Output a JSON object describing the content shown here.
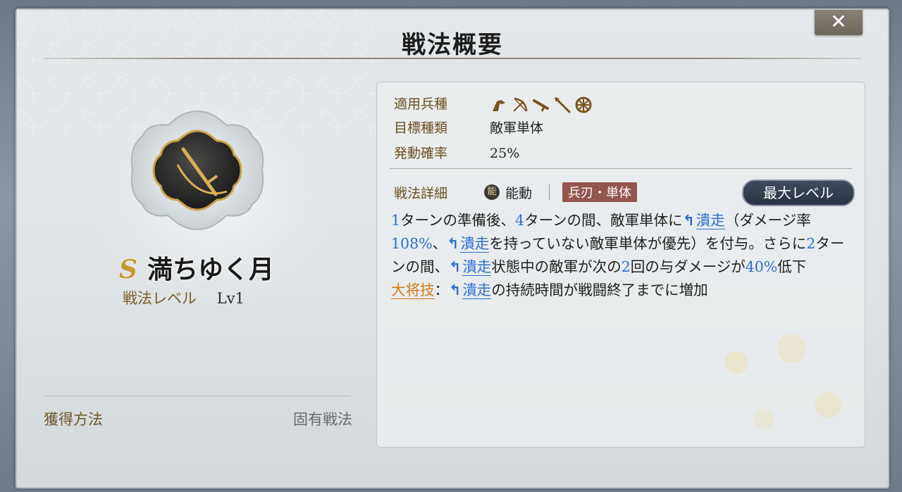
{
  "dialog": {
    "title": "戦法概要",
    "close_label": "✕"
  },
  "tactic": {
    "rank": "S",
    "name": "満ちゆく月",
    "level_label": "戦法レベル",
    "level_value": "Lv1",
    "acquisition_label": "獲得方法",
    "acquisition_value": "固有戦法"
  },
  "info": {
    "unit_label": "適用兵種",
    "unit_icons": [
      "cavalry-icon",
      "bow-icon",
      "gun-icon",
      "spear-icon",
      "shield-icon"
    ],
    "target_label": "目標種類",
    "target_value": "敵軍単体",
    "rate_label": "発動確率",
    "rate_value": "25%"
  },
  "detail": {
    "label": "戦法詳細",
    "type_icon": "能",
    "type_value": "能動",
    "tag": "兵刃・単体",
    "max_level_button": "最大レベル"
  },
  "description": {
    "p1": "1",
    "t1": "ターンの準備後、",
    "p2": "4",
    "t2": "ターンの間、敵軍単体に",
    "e1": "潰走",
    "t3": "（ダメージ率",
    "p3": "108%",
    "t4": "、",
    "e2": "潰走",
    "t5": "を持っていない敵軍単体が優先）を付与。さらに",
    "p4": "2",
    "t6": "ターンの間、",
    "e3": "潰走",
    "t7": "状態中の敵軍が次の",
    "p5": "2",
    "t8": "回の与ダメージが",
    "p6": "40%",
    "t9": "低下",
    "gen_label": "大将技",
    "gen_sep": "：",
    "e4": "潰走",
    "t10": "の持続時間が戦闘終了までに増加"
  },
  "colors": {
    "accent_blue": "#2a6fd1",
    "general_orange": "#d17a14",
    "label_brown": "#6a4f22",
    "tag_red": "#93564d",
    "rank_gold": "#c49a2b"
  }
}
